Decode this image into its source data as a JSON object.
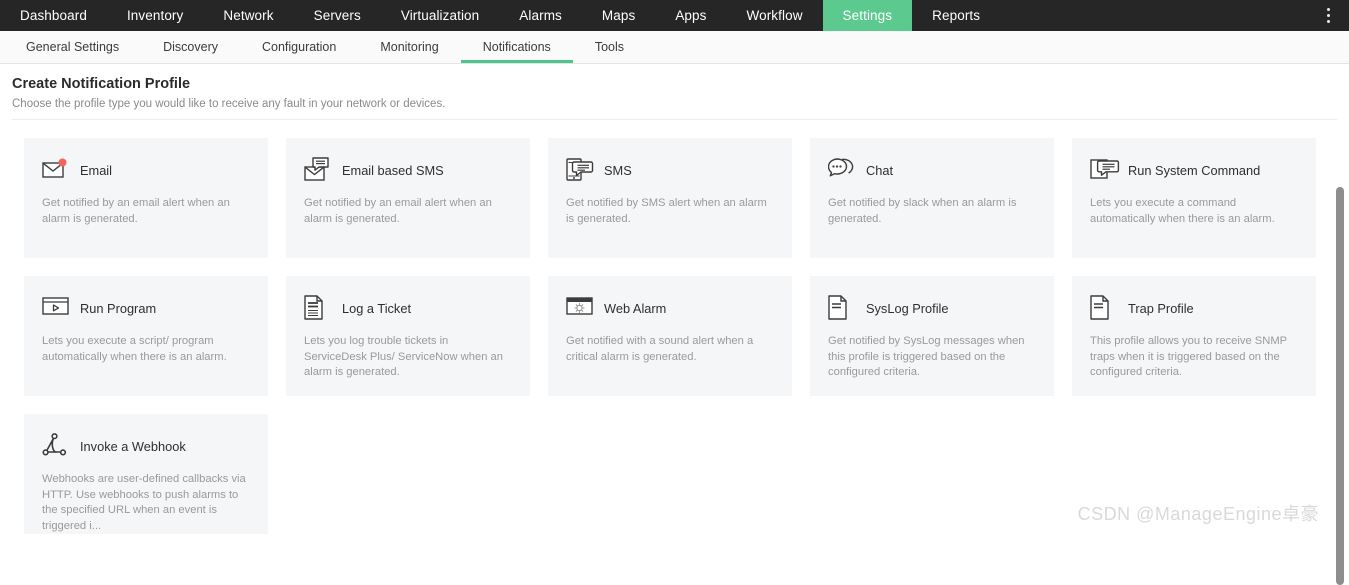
{
  "topnav": {
    "items": [
      {
        "label": "Dashboard",
        "active": false
      },
      {
        "label": "Inventory",
        "active": false
      },
      {
        "label": "Network",
        "active": false
      },
      {
        "label": "Servers",
        "active": false
      },
      {
        "label": "Virtualization",
        "active": false
      },
      {
        "label": "Alarms",
        "active": false
      },
      {
        "label": "Maps",
        "active": false
      },
      {
        "label": "Apps",
        "active": false
      },
      {
        "label": "Workflow",
        "active": false
      },
      {
        "label": "Settings",
        "active": true
      },
      {
        "label": "Reports",
        "active": false
      }
    ],
    "overflow_icon": "kebab-menu-icon",
    "active_color": "#5cc98f",
    "background_color": "#262626"
  },
  "subnav": {
    "items": [
      {
        "label": "General Settings",
        "active": false
      },
      {
        "label": "Discovery",
        "active": false
      },
      {
        "label": "Configuration",
        "active": false
      },
      {
        "label": "Monitoring",
        "active": false
      },
      {
        "label": "Notifications",
        "active": true
      },
      {
        "label": "Tools",
        "active": false
      }
    ],
    "active_underline_color": "#4ec58a"
  },
  "page": {
    "title": "Create Notification Profile",
    "subtitle": "Choose the profile type you would like to receive any fault in your network or devices."
  },
  "cards": [
    {
      "title": "Email",
      "description": "Get notified by an email alert when an alarm is generated.",
      "icon": "envelope-with-badge-icon",
      "badge_color": "#f4645f"
    },
    {
      "title": "Email based SMS",
      "description": "Get notified by an email alert when an alarm is generated.",
      "icon": "envelope-with-message-icon"
    },
    {
      "title": "SMS",
      "description": "Get notified by SMS alert when an alarm is generated.",
      "icon": "phone-with-message-icon"
    },
    {
      "title": "Chat",
      "description": "Get notified by slack when an alarm is generated.",
      "icon": "chat-bubbles-icon"
    },
    {
      "title": "Run System Command",
      "description": "Lets you execute a command automatically when there is an alarm.",
      "icon": "window-with-message-icon"
    },
    {
      "title": "Run Program",
      "description": "Lets you execute a script/ program automatically when there is an alarm.",
      "icon": "window-play-icon"
    },
    {
      "title": "Log a Ticket",
      "description": "Lets you log trouble tickets in ServiceDesk Plus/ ServiceNow when an alarm is generated.",
      "icon": "document-ticket-icon"
    },
    {
      "title": "Web Alarm",
      "description": "Get notified with a sound alert when a critical alarm is generated.",
      "icon": "browser-alarm-icon"
    },
    {
      "title": "SysLog Profile",
      "description": "Get notified by SysLog messages when this profile is triggered based on the configured criteria.",
      "icon": "document-syslog-icon"
    },
    {
      "title": "Trap Profile",
      "description": "This profile allows you to receive SNMP traps when it is triggered based on the configured criteria.",
      "icon": "document-trap-icon"
    },
    {
      "title": "Invoke a Webhook",
      "description": "Webhooks are user-defined callbacks via HTTP. Use webhooks to push alarms to the specified URL when an event is triggered i...",
      "icon": "webhook-nodes-icon"
    }
  ],
  "watermark": "CSDN @ManageEngine卓豪"
}
